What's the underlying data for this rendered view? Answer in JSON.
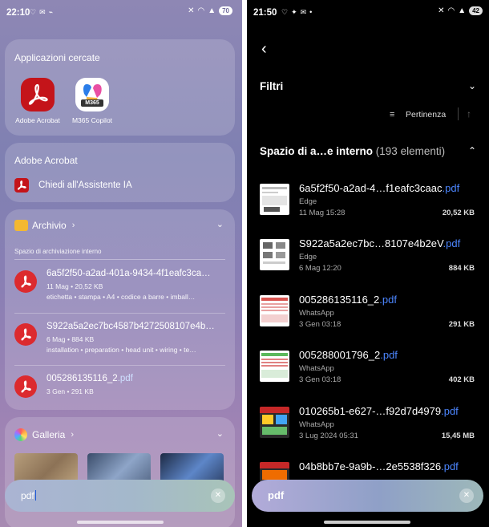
{
  "left": {
    "status": {
      "time": "22:10",
      "notif_glyphs": [
        "♡",
        "✉",
        "⌁"
      ],
      "sys_glyphs": [
        "✕",
        "◠",
        "▲"
      ],
      "battery": "70"
    },
    "searched_apps": {
      "title": "Applicazioni cercate",
      "apps": [
        {
          "label": "Adobe Acrobat"
        },
        {
          "label": "M365 Copilot",
          "icon_text": "M365"
        }
      ]
    },
    "acrobat_card": {
      "title": "Adobe Acrobat",
      "action_label": "Chiedi all'Assistente IA"
    },
    "archive": {
      "title": "Archivio",
      "chevron_right": "›",
      "chevron_down": "⌄",
      "storage_label": "Spazio di archiviazione interno",
      "files": [
        {
          "name": "6a5f2f50-a2ad-401a-9434-4f1eafc3ca…",
          "ext": "",
          "meta": "11 Mag • 20,52 KB",
          "tags": "etichetta • stampa • A4 • codice a barre • imball…"
        },
        {
          "name": "S922a5a2ec7bc4587b4272508107e4b…",
          "ext": "",
          "meta": "6 Mag • 884 KB",
          "tags": "installation • preparation • head unit • wiring • te…"
        },
        {
          "name": "005286135116_2",
          "ext": ".pdf",
          "meta": "3 Gen • 291 KB",
          "tags": ""
        }
      ]
    },
    "gallery": {
      "title": "Galleria",
      "chevron_right": "›",
      "chevron_down": "⌄"
    },
    "search": {
      "query": "pdf",
      "clear": "✕"
    }
  },
  "right": {
    "status": {
      "time": "21:50",
      "notif_glyphs": [
        "♡",
        "✦",
        "✉",
        "•"
      ],
      "sys_glyphs": [
        "✕",
        "◠",
        "▲"
      ],
      "battery": "42"
    },
    "back": "‹",
    "filters_label": "Filtri",
    "chevron_down": "⌄",
    "sort_icon": "≡",
    "sort_label": "Pertinenza",
    "sort_direction": "↑",
    "section": {
      "title": "Spazio di a…e interno",
      "count": "(193 elementi)",
      "chevron_up": "⌃"
    },
    "files": [
      {
        "name": "6a5f2f50-a2ad-4…f1eafc3caac",
        "ext": ".pdf",
        "source": "Edge",
        "date": "11 Mag 15:28",
        "size": "20,52 KB"
      },
      {
        "name": "S922a5a2ec7bc…8107e4b2eV",
        "ext": ".pdf",
        "source": "Edge",
        "date": "6 Mag 12:20",
        "size": "884 KB"
      },
      {
        "name": "005286135116_2",
        "ext": ".pdf",
        "source": "WhatsApp",
        "date": "3 Gen 03:18",
        "size": "291 KB"
      },
      {
        "name": "005288001796_2",
        "ext": ".pdf",
        "source": "WhatsApp",
        "date": "3 Gen 03:18",
        "size": "402 KB"
      },
      {
        "name": "010265b1-e627-…f92d7d4979",
        "ext": ".pdf",
        "source": "WhatsApp",
        "date": "3 Lug 2024 05:31",
        "size": "15,45 MB"
      },
      {
        "name": "04b8bb7e-9a9b-…2e5538f326",
        "ext": ".pdf",
        "source": "",
        "date": "",
        "size": ""
      }
    ],
    "search": {
      "query": "pdf",
      "clear": "✕"
    }
  }
}
